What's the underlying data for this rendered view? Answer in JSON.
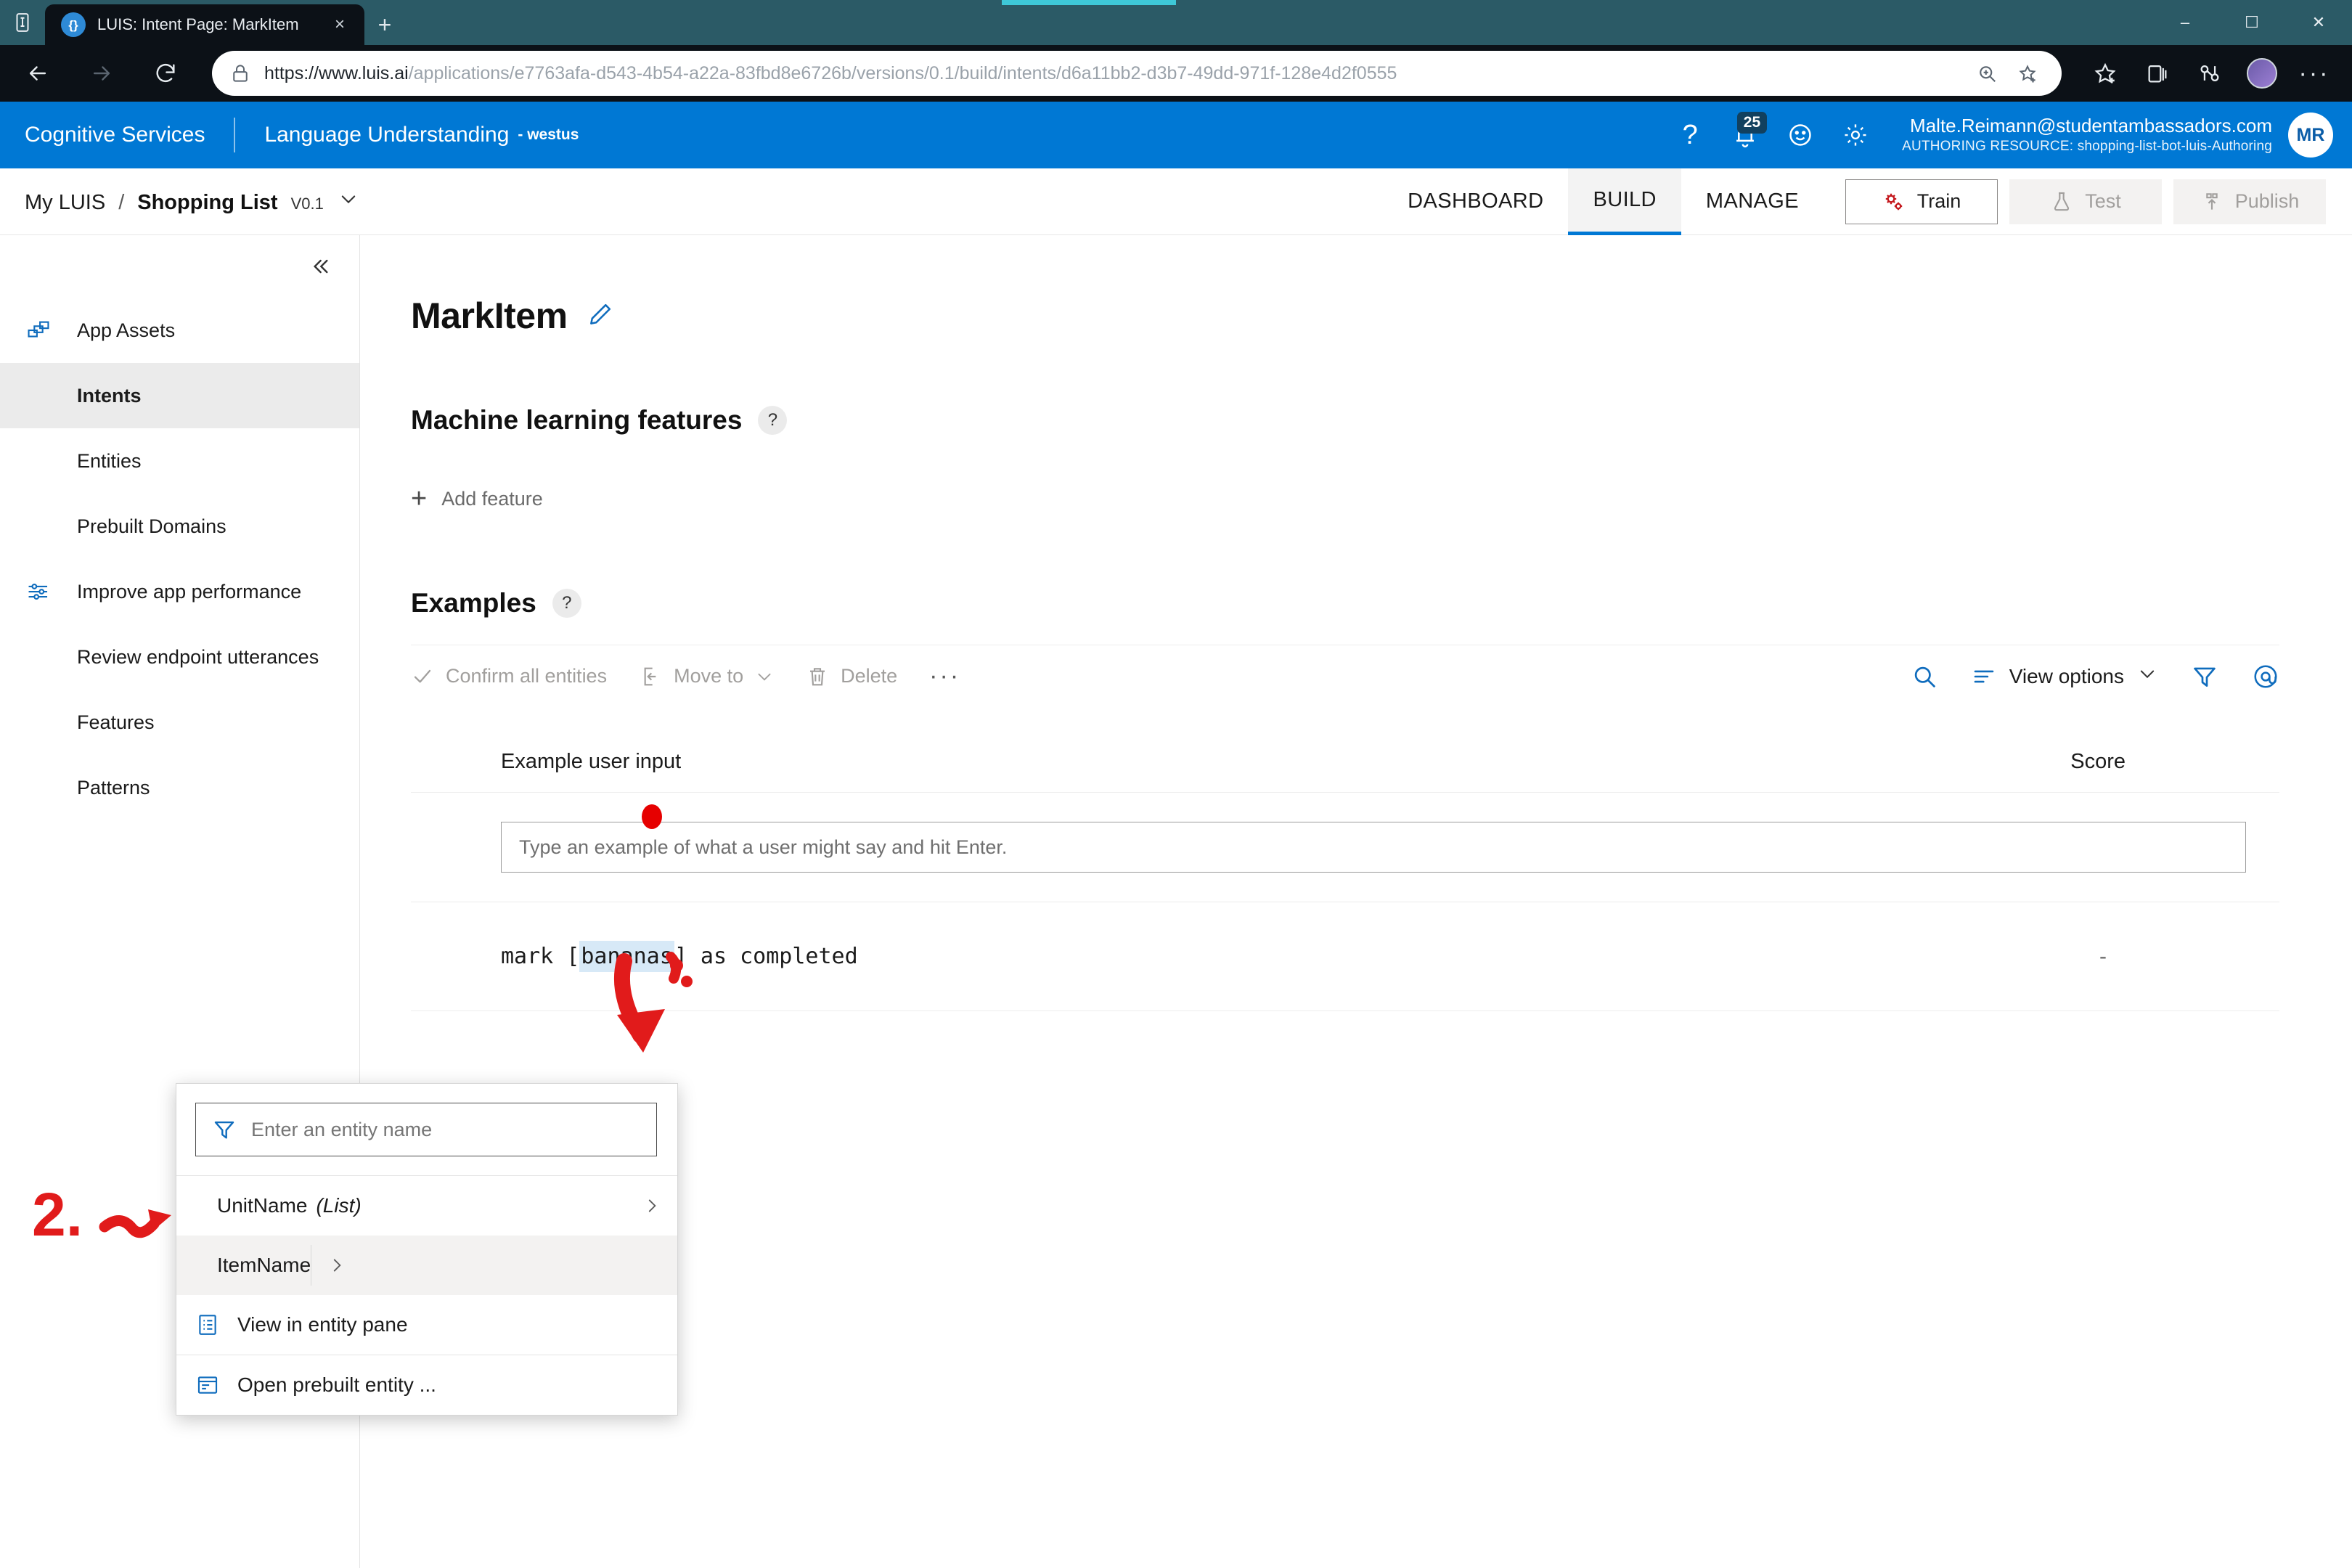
{
  "browser": {
    "tab": {
      "title": "LUIS: Intent Page: MarkItem",
      "favicon_glyph": "{}",
      "close_glyph": "×"
    },
    "new_tab_glyph": "+",
    "window_controls": {
      "minimize": "–",
      "maximize": "☐",
      "close": "✕"
    },
    "url": {
      "scheme": "https://",
      "host": "www.luis.ai",
      "path": "/applications/e7763afa-d543-4b54-a22a-83fbd8e6726b/versions/0.1/build/intents/d6a11bb2-d3b7-49dd-971f-128e4d2f0555"
    },
    "toolbar_icons": [
      "back-icon",
      "forward-icon",
      "refresh-icon",
      "lock-icon",
      "zoom-icon",
      "favorite-add-icon",
      "favorites-icon",
      "collections-icon",
      "browser-essentials-icon",
      "profile-avatar",
      "settings-more-icon"
    ],
    "more_glyph": "···"
  },
  "header": {
    "product": "Cognitive Services",
    "service": "Language Understanding",
    "region": "- westus",
    "help_glyph": "?",
    "notification_badge": "25",
    "account_email": "Malte.Reimann@studentambassadors.com",
    "authoring_resource_label": "AUTHORING RESOURCE:",
    "authoring_resource_value": "shopping-list-bot-luis-Authoring",
    "avatar_initials": "MR",
    "accent_color": "#0078d4"
  },
  "appnav": {
    "breadcrumb_root": "My LUIS",
    "breadcrumb_sep": "/",
    "app_name": "Shopping List",
    "version": "V0.1",
    "tabs": [
      {
        "label": "DASHBOARD",
        "active": false
      },
      {
        "label": "BUILD",
        "active": true
      },
      {
        "label": "MANAGE",
        "active": false
      }
    ],
    "actions": [
      {
        "label": "Train",
        "icon": "gears-icon",
        "disabled": false
      },
      {
        "label": "Test",
        "icon": "flask-icon",
        "disabled": true
      },
      {
        "label": "Publish",
        "icon": "publish-icon",
        "disabled": true
      }
    ]
  },
  "sidebar": {
    "collapse_icon": "chevron-double-left-icon",
    "items": [
      {
        "label": "App Assets",
        "icon": "app-assets-icon",
        "active": false
      },
      {
        "label": "Intents",
        "icon": "",
        "active": true
      },
      {
        "label": "Entities",
        "icon": "",
        "active": false
      },
      {
        "label": "Prebuilt Domains",
        "icon": "",
        "active": false
      },
      {
        "label": "Improve app performance",
        "icon": "sliders-icon",
        "active": false
      },
      {
        "label": "Review endpoint utterances",
        "icon": "",
        "active": false
      },
      {
        "label": "Features",
        "icon": "",
        "active": false
      },
      {
        "label": "Patterns",
        "icon": "",
        "active": false
      }
    ]
  },
  "main": {
    "page_title": "MarkItem",
    "edit_icon": "pencil-icon",
    "ml_features": {
      "title": "Machine learning features",
      "help_glyph": "?",
      "add_feature_label": "Add feature",
      "add_glyph": "+"
    },
    "examples": {
      "title": "Examples",
      "help_glyph": "?",
      "toolbar": {
        "confirm_all": "Confirm all entities",
        "move_to": "Move to",
        "delete": "Delete",
        "overflow": "···",
        "search_icon": "search-icon",
        "view_options": "View options",
        "filter_icon": "filter-icon",
        "entity_icon": "at-entity-icon"
      },
      "columns": {
        "example": "Example user input",
        "score": "Score"
      },
      "new_utterance_placeholder": "Type an example of what a user might say and hit Enter.",
      "rows": [
        {
          "prefix": "mark ",
          "open_bracket": "[",
          "entity_text": "bananas",
          "close_bracket": "]",
          "suffix": " as completed",
          "score": "-"
        }
      ]
    }
  },
  "context_menu": {
    "search_placeholder": "Enter an entity name",
    "filter_icon": "funnel-icon",
    "items": [
      {
        "label": "UnitName",
        "suffix": "(List)",
        "highlighted": false,
        "has_submenu": true,
        "icon": ""
      },
      {
        "label": "ItemName",
        "suffix": "",
        "highlighted": true,
        "has_submenu": true,
        "icon": ""
      },
      {
        "label": "View in entity pane",
        "suffix": "",
        "highlighted": false,
        "has_submenu": false,
        "icon": "entity-pane-icon"
      },
      {
        "label": "Open prebuilt entity ...",
        "suffix": "",
        "highlighted": false,
        "has_submenu": false,
        "icon": "prebuilt-entity-icon"
      }
    ]
  },
  "annotations": {
    "color": "#e11b1b",
    "step_two_label": "2.",
    "arrow_icon": "down-arrow-annotation",
    "dot_icon": "red-dot-annotation"
  }
}
